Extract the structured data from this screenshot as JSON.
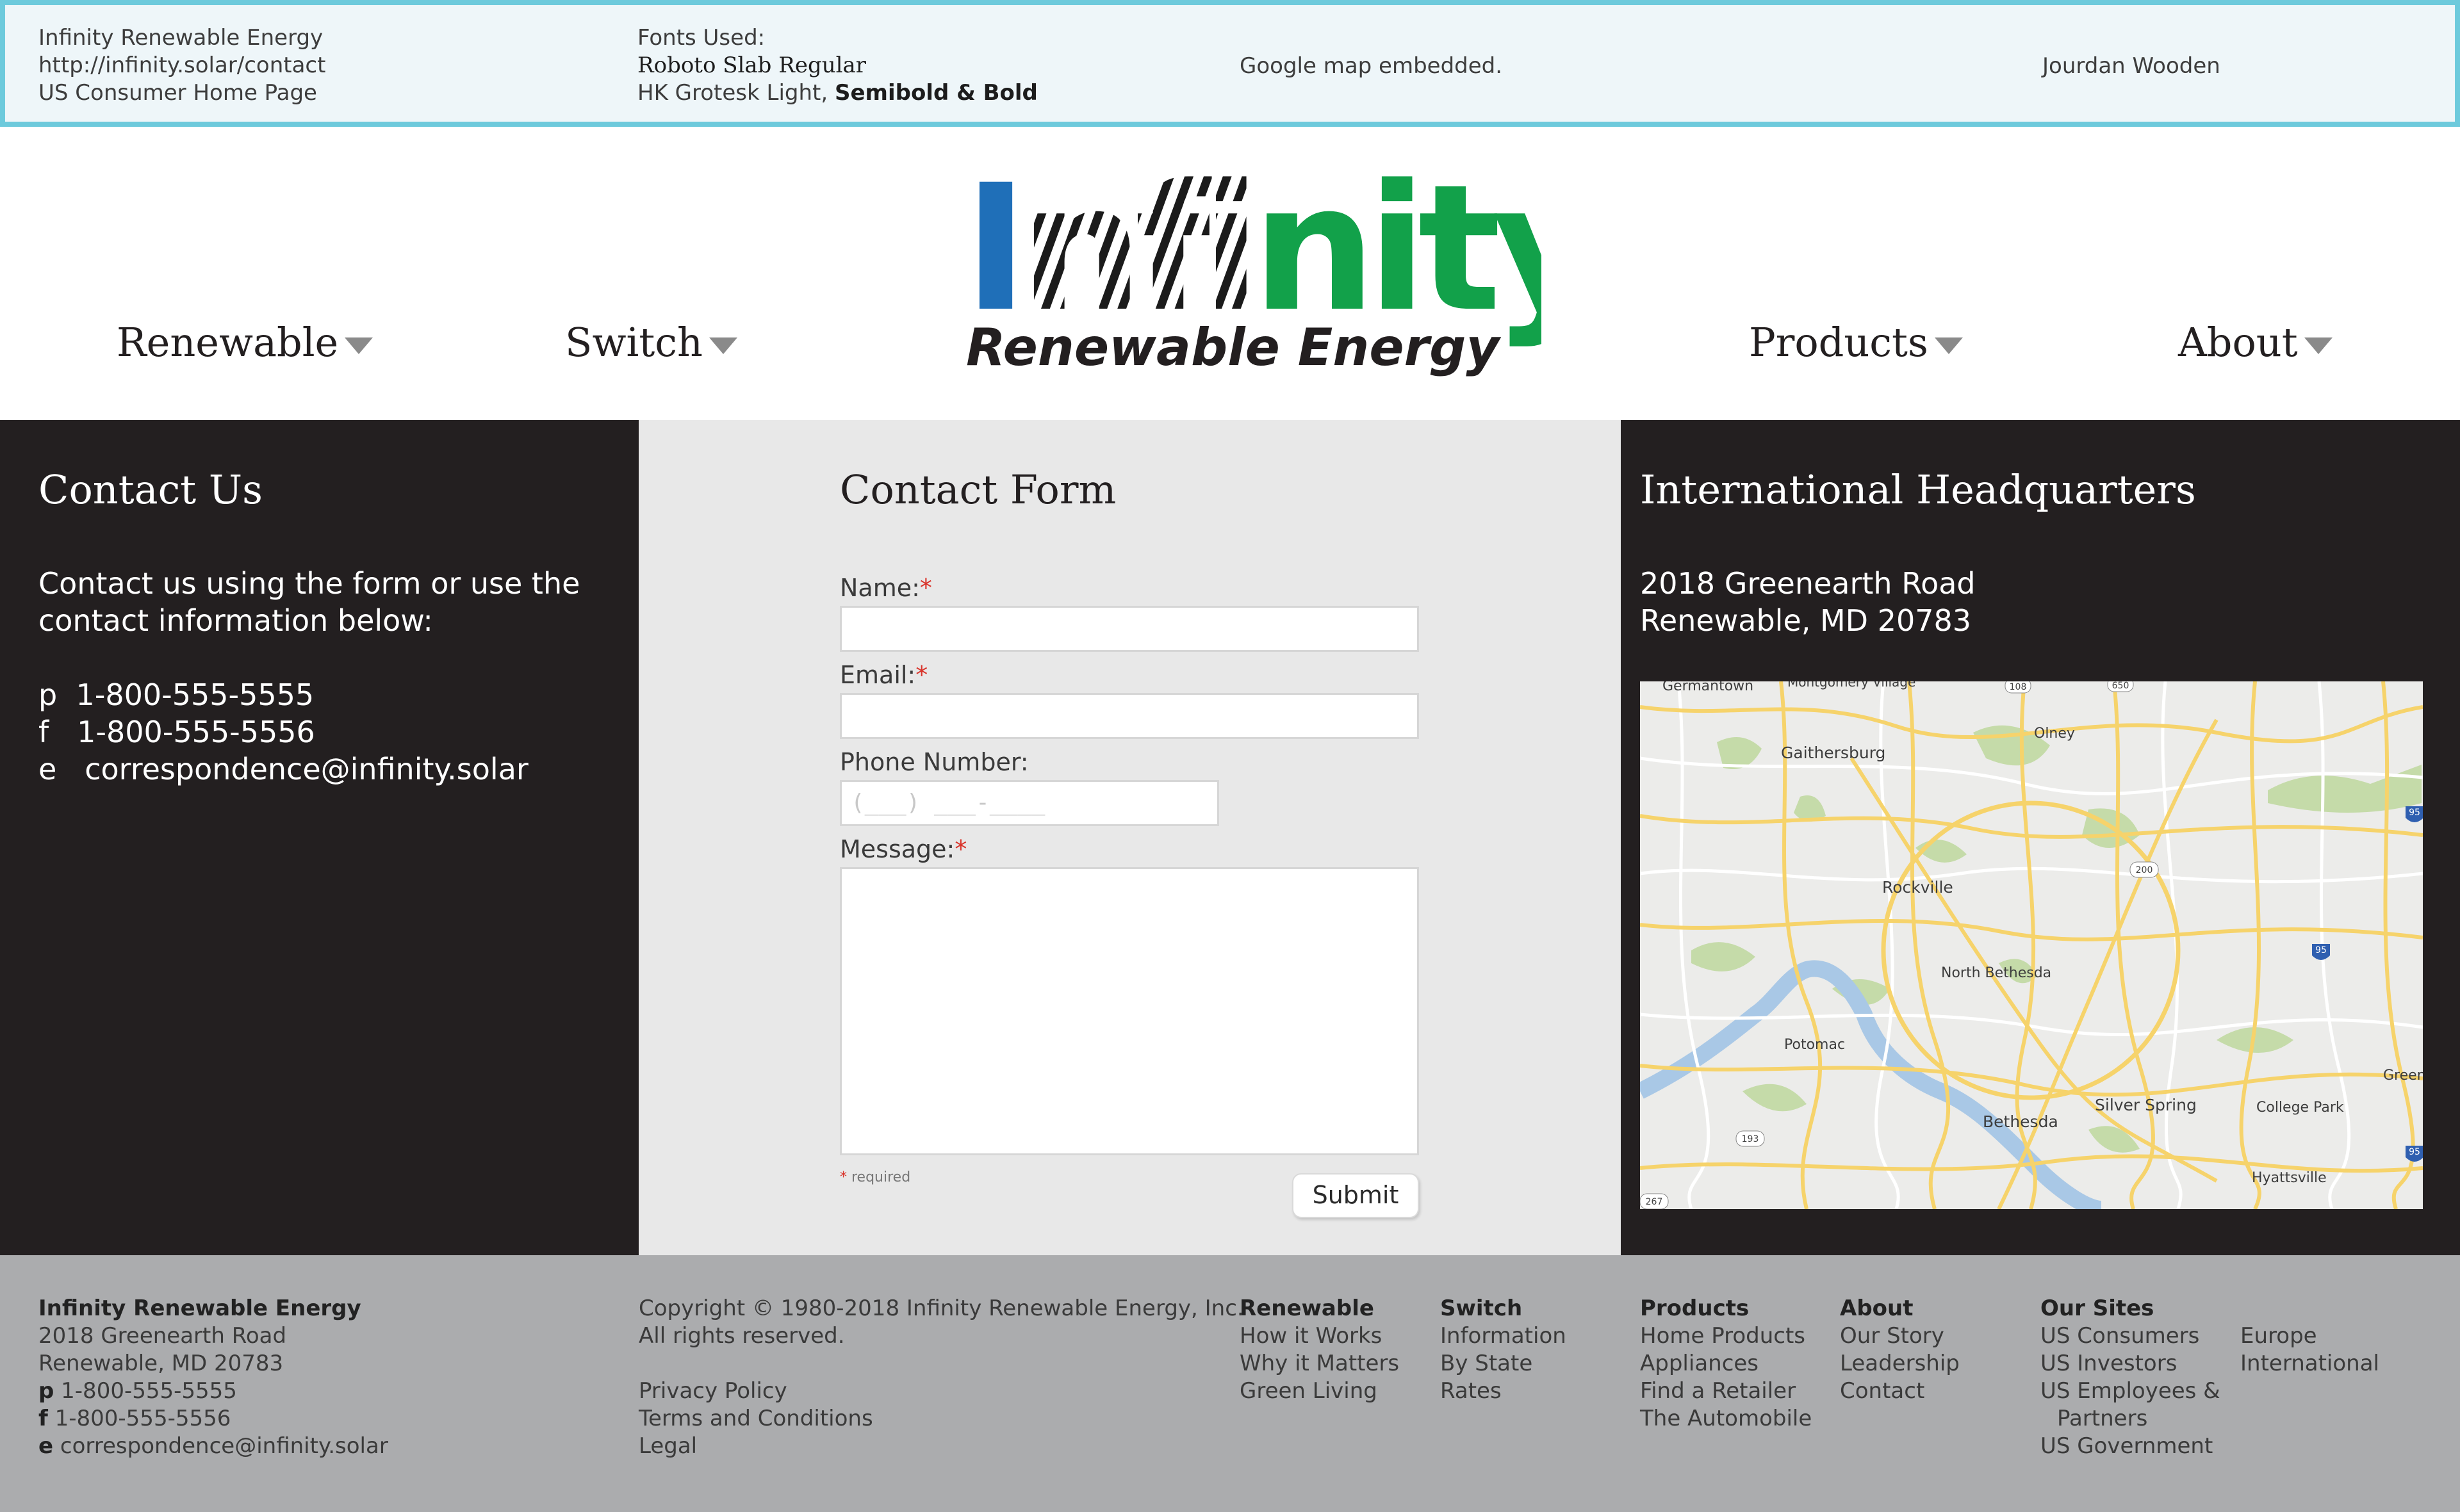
{
  "info_bar": {
    "company": "Infinity Renewable Energy",
    "url": "http://infinity.solar/contact",
    "page": "US Consumer Home Page",
    "fonts_heading": "Fonts Used:",
    "font1": "Roboto Slab Regular",
    "font2_prefix": "HK Grotesk Light, ",
    "font2_bold": "Semibold & Bold",
    "map_note": "Google map embedded.",
    "author": "Jourdan Wooden"
  },
  "logo": {
    "wordmark": "Infinity",
    "tagline": "Renewable Energy",
    "blue": "#1f6fb8",
    "green": "#12a14a"
  },
  "nav": {
    "renewable": "Renewable",
    "switch": "Switch",
    "products": "Products",
    "about": "About"
  },
  "contact": {
    "title": "Contact Us",
    "intro_line1": "Contact us using the form or use the",
    "intro_line2": "contact information below:",
    "phone_prefix": "p",
    "phone": "1-800-555-5555",
    "fax_prefix": "f",
    "fax": "1-800-555-5556",
    "email_prefix": "e",
    "email": "correspondence@infinity.solar"
  },
  "form": {
    "title": "Contact Form",
    "name_label": "Name:",
    "email_label": "Email:",
    "phone_label": "Phone Number:",
    "phone_placeholder": "(___) ___-____",
    "message_label": "Message:",
    "required_mark": "*",
    "required_note": "required",
    "submit": "Submit"
  },
  "hq": {
    "title": "International Headquarters",
    "address1": "2018 Greenearth Road",
    "address2": "Renewable, MD 20783",
    "map_labels": [
      "Germantown",
      "Montgomery Village",
      "Olney",
      "Gaithersburg",
      "Rockville",
      "North Bethesda",
      "Potomac",
      "Bethesda",
      "Silver Spring",
      "College Park",
      "Hyattsville",
      "Greenb"
    ],
    "map_shields": [
      "108",
      "650",
      "200",
      "95",
      "95",
      "193",
      "267",
      "95"
    ]
  },
  "footer": {
    "company": "Infinity Renewable Energy",
    "address1": "2018 Greenearth Road",
    "address2": "Renewable, MD 20783",
    "phone_prefix": "p",
    "phone": "1-800-555-5555",
    "fax_prefix": "f",
    "fax": "1-800-555-5556",
    "email_prefix": "e",
    "email": "correspondence@infinity.solar",
    "copyright": "Copyright © 1980-2018 Infinity Renewable Energy, Inc.",
    "rights": "All rights reserved.",
    "privacy": "Privacy Policy",
    "terms": "Terms and Conditions",
    "legal": "Legal",
    "renewable": {
      "heading": "Renewable",
      "links": [
        "How it Works",
        "Why it Matters",
        "Green Living"
      ]
    },
    "switch": {
      "heading": "Switch",
      "links": [
        "Information",
        "By State",
        "Rates"
      ]
    },
    "products": {
      "heading": "Products",
      "links": [
        "Home Products",
        "Appliances",
        "Find a Retailer",
        "The Automobile"
      ]
    },
    "about": {
      "heading": "About",
      "links": [
        "Our Story",
        "Leadership",
        "Contact"
      ]
    },
    "sites": {
      "heading": "Our Sites",
      "links": [
        "US Consumers",
        "US Investors",
        "US Employees &",
        "Partners",
        "US Government"
      ],
      "links2": [
        "Europe",
        "International"
      ]
    }
  }
}
